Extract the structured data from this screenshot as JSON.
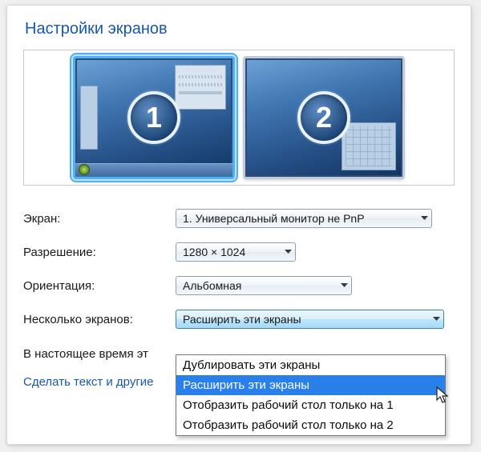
{
  "title": "Настройки экранов",
  "monitors": {
    "one": "1",
    "two": "2"
  },
  "labels": {
    "screen": "Экран:",
    "resolution": "Разрешение:",
    "orientation": "Ориентация:",
    "multi": "Несколько экранов:"
  },
  "values": {
    "screen": "1. Универсальный монитор не PnP",
    "resolution": "1280 × 1024",
    "orientation": "Альбомная",
    "multi": "Расширить эти экраны"
  },
  "multi_options": [
    "Дублировать эти экраны",
    "Расширить эти экраны",
    "Отобразить рабочий стол только на 1",
    "Отобразить рабочий стол только на 2"
  ],
  "multi_selected_index": 1,
  "note_prefix": "В настоящее время эт",
  "link_prefix": "Сделать текст и другие "
}
